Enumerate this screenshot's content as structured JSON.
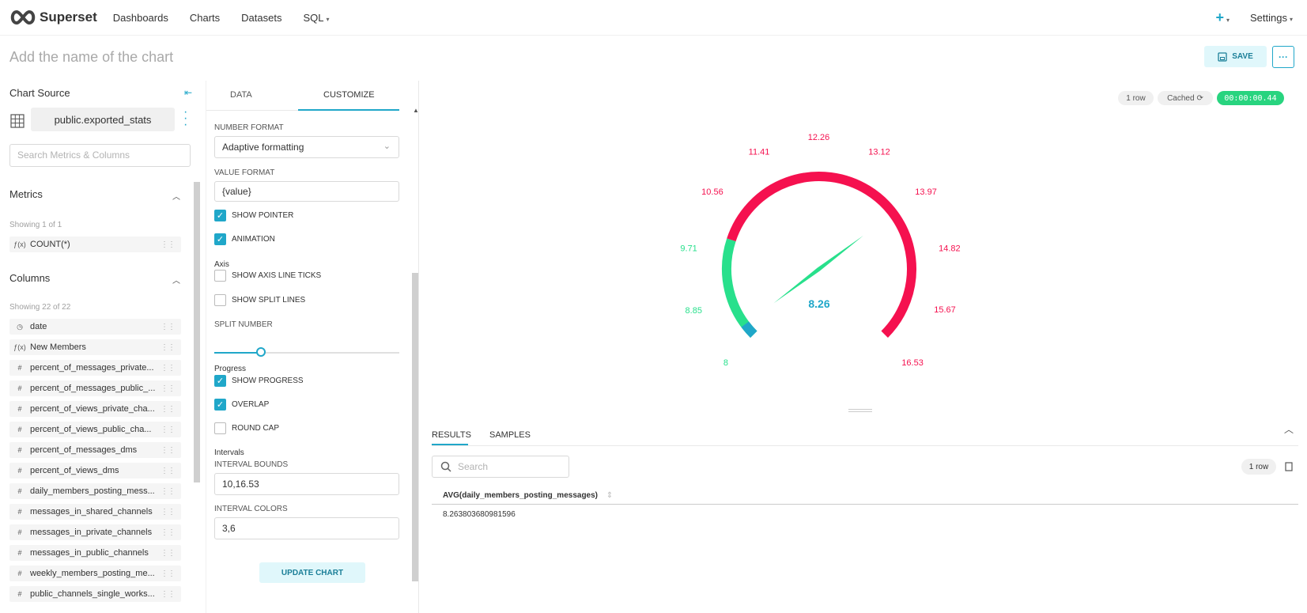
{
  "nav": {
    "brand": "Superset",
    "links": [
      "Dashboards",
      "Charts",
      "Datasets",
      "SQL"
    ],
    "plus": "+",
    "settings": "Settings"
  },
  "header": {
    "chart_name_placeholder": "Add the name of the chart",
    "save_label": "SAVE",
    "more_label": "···"
  },
  "datasource": {
    "section_label": "Chart Source",
    "dataset_name": "public.exported_stats",
    "search_placeholder": "Search Metrics & Columns",
    "metrics": {
      "title": "Metrics",
      "showing": "Showing 1 of 1",
      "items": [
        {
          "icon": "ƒ(x)",
          "label": "COUNT(*)"
        }
      ]
    },
    "columns": {
      "title": "Columns",
      "showing": "Showing 22 of 22",
      "items": [
        {
          "icon": "◷",
          "label": "date"
        },
        {
          "icon": "ƒ(x)",
          "label": "New Members"
        },
        {
          "icon": "#",
          "label": "percent_of_messages_private..."
        },
        {
          "icon": "#",
          "label": "percent_of_messages_public_..."
        },
        {
          "icon": "#",
          "label": "percent_of_views_private_cha..."
        },
        {
          "icon": "#",
          "label": "percent_of_views_public_cha..."
        },
        {
          "icon": "#",
          "label": "percent_of_messages_dms"
        },
        {
          "icon": "#",
          "label": "percent_of_views_dms"
        },
        {
          "icon": "#",
          "label": "daily_members_posting_mess..."
        },
        {
          "icon": "#",
          "label": "messages_in_shared_channels"
        },
        {
          "icon": "#",
          "label": "messages_in_private_channels"
        },
        {
          "icon": "#",
          "label": "messages_in_public_channels"
        },
        {
          "icon": "#",
          "label": "weekly_members_posting_me..."
        },
        {
          "icon": "#",
          "label": "public_channels_single_works..."
        }
      ]
    }
  },
  "customize": {
    "tabs": [
      "DATA",
      "CUSTOMIZE"
    ],
    "number_format_label": "NUMBER FORMAT",
    "number_format_value": "Adaptive formatting",
    "value_format_label": "VALUE FORMAT",
    "value_format_value": "{value}",
    "show_pointer": "SHOW POINTER",
    "animation": "ANIMATION",
    "axis_label": "Axis",
    "show_axis_line_ticks": "SHOW AXIS LINE TICKS",
    "show_split_lines": "SHOW SPLIT LINES",
    "split_number_label": "SPLIT NUMBER",
    "split_number_fraction": 0.25,
    "progress_label": "Progress",
    "show_progress": "SHOW PROGRESS",
    "overlap": "OVERLAP",
    "round_cap": "ROUND CAP",
    "intervals_label": "Intervals",
    "interval_bounds_label": "INTERVAL BOUNDS",
    "interval_bounds_value": "10,16.53",
    "interval_colors_label": "INTERVAL COLORS",
    "interval_colors_value": "3,6",
    "update_label": "UPDATE CHART"
  },
  "chart_header": {
    "rows": "1 row",
    "cached": "Cached",
    "timer": "00:00:00.44"
  },
  "chart_data": {
    "type": "gauge",
    "min": 8,
    "max": 16.53,
    "value": 8.26,
    "value_label": "8.26",
    "tick_labels": [
      "8",
      "8.85",
      "9.71",
      "10.56",
      "11.41",
      "12.26",
      "13.12",
      "13.97",
      "14.82",
      "15.67",
      "16.53"
    ],
    "intervals": [
      {
        "upto": 10,
        "color": "#28e08c"
      },
      {
        "upto": 16.53,
        "color": "#f5114f"
      }
    ],
    "colors": {
      "green": "#28e08c",
      "red": "#f5114f",
      "value": "#20a7c9"
    }
  },
  "results": {
    "tabs": [
      "RESULTS",
      "SAMPLES"
    ],
    "search_placeholder": "Search",
    "row_count": "1 row",
    "column": "AVG(daily_members_posting_messages)",
    "cell": "8.263803680981596"
  },
  "colors": {
    "accent": "#20a7c9"
  }
}
